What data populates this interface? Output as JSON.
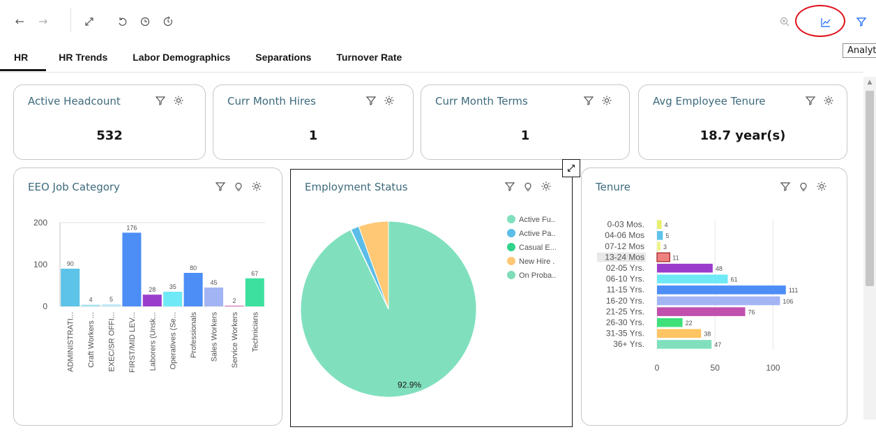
{
  "toolbar": {
    "icons": [
      "undo-icon",
      "redo-icon",
      "fit-to-window-icon",
      "reset-icon",
      "history-icon",
      "refresh-timer-icon",
      "zoom-icon",
      "analytics-icon",
      "filter-icon"
    ],
    "tooltip": "Analytics"
  },
  "tabs": [
    "HR",
    "HR Trends",
    "Labor Demographics",
    "Separations",
    "Turnover Rate"
  ],
  "active_tab": "HR",
  "kpis": [
    {
      "title": "Active Headcount",
      "value": "532"
    },
    {
      "title": "Curr Month Hires",
      "value": "1"
    },
    {
      "title": "Curr Month Terms",
      "value": "1"
    },
    {
      "title": "Avg Employee Tenure",
      "value": "18.7 year(s)"
    }
  ],
  "colors": {
    "accent": "#0f62fe",
    "title": "#3d6a7c",
    "highlight_circle": "#e0101a"
  },
  "chart_data": [
    {
      "title": "EEO Job Category",
      "type": "bar",
      "categories": [
        "ADMINISTRATI...",
        "Craft Workers ...",
        "EXEC/SR OFFI...",
        "FIRST/MID LEV...",
        "Laborers (Unsk...",
        "Operatives (Se...",
        "Professionals",
        "Sales Workers",
        "Service Workers",
        "Technicians"
      ],
      "values": [
        90,
        4,
        5,
        176,
        28,
        35,
        80,
        45,
        2,
        67
      ],
      "colors": [
        "#5ec3e8",
        "#a7e1f4",
        "#c0e7f5",
        "#4c8df6",
        "#9b3dcc",
        "#6ee9f5",
        "#4c8df6",
        "#a3b4f4",
        "#d98cc7",
        "#3ee0a0"
      ],
      "yticks": [
        0,
        100,
        200
      ],
      "ylim": [
        0,
        200
      ]
    },
    {
      "title": "Employment Status",
      "type": "pie",
      "labels": [
        "Active Fu..",
        "Active Pa..",
        "Casual E...",
        "New Hire .",
        "On Proba.."
      ],
      "values": [
        92.9,
        1.5,
        0.1,
        5.5,
        0
      ],
      "colors": [
        "#80e0bd",
        "#5bbde8",
        "#2fd38a",
        "#ffc875",
        "#7fdcb8"
      ],
      "data_label": "92.9%"
    },
    {
      "title": "Tenure",
      "type": "bar",
      "orientation": "horizontal",
      "categories": [
        "0-03 Mos.",
        "04-06 Mos",
        "07-12 Mos",
        "13-24 Mos",
        "02-05 Yrs.",
        "06-10 Yrs.",
        "11-15 Yrs.",
        "16-20 Yrs.",
        "21-25 Yrs.",
        "26-30 Yrs.",
        "31-35 Yrs.",
        "36+ Yrs."
      ],
      "values": [
        4,
        5,
        3,
        11,
        48,
        61,
        111,
        106,
        76,
        22,
        38,
        47
      ],
      "colors": [
        "#e7f06e",
        "#5ec3e8",
        "#eef48a",
        "#ee8080",
        "#9b3dcc",
        "#6ee9f5",
        "#4c8df6",
        "#a3b4f4",
        "#c04fae",
        "#3ee07a",
        "#ffc463",
        "#80e0bd"
      ],
      "xticks": [
        0,
        50,
        100
      ],
      "xlim": [
        0,
        125
      ]
    }
  ]
}
